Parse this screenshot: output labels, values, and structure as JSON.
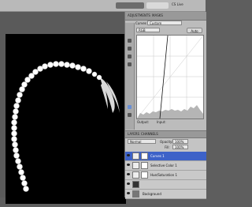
{
  "topbar": {
    "workspace_label": "",
    "workspace2_label": "",
    "cs_live": "CS Live"
  },
  "adjustments": {
    "tabs": [
      "ADJUSTMENTS",
      "MASKS"
    ],
    "curves_label": "Curves",
    "preset": "Custom",
    "channel": "RGB",
    "auto_label": "Auto",
    "output_label": "Output:",
    "input_label": "Input:"
  },
  "layers": {
    "tabs": [
      "LAYERS",
      "CHANNELS"
    ],
    "blend_mode": "Normal",
    "opacity_label": "Opacity:",
    "opacity_value": "100%",
    "fill_label": "Fill:",
    "fill_value": "100%",
    "items": [
      {
        "name": "Curves 1",
        "selected": true
      },
      {
        "name": "Selective Color 1",
        "selected": false
      },
      {
        "name": "Hue/Saturation 1",
        "selected": false
      },
      {
        "name": "",
        "selected": false
      },
      {
        "name": "Background",
        "selected": false
      }
    ]
  }
}
